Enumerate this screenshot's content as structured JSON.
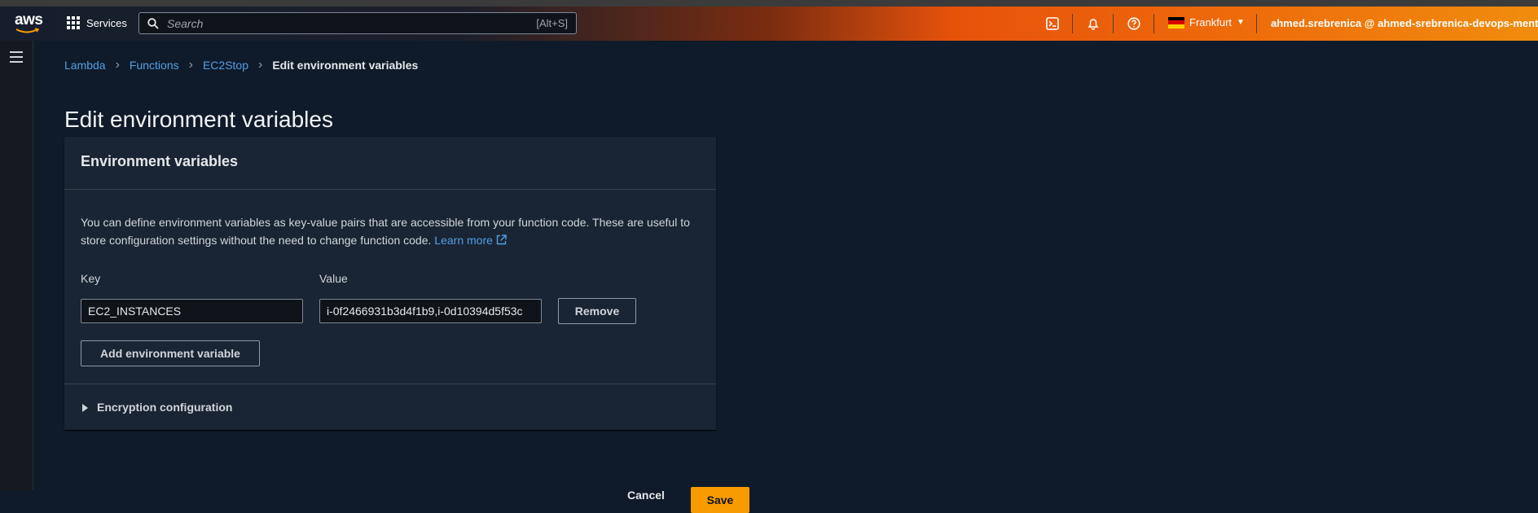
{
  "nav": {
    "logo_text": "aws",
    "services_label": "Services",
    "search_placeholder": "Search",
    "search_shortcut": "[Alt+S]",
    "region": "Frankfurt",
    "account": "ahmed.srebrenica @ ahmed-srebrenica-devops-mentorship",
    "icons": [
      "cloudshell-icon",
      "bell-icon",
      "help-icon"
    ]
  },
  "breadcrumb": {
    "items": [
      "Lambda",
      "Functions",
      "EC2Stop"
    ],
    "current": "Edit environment variables"
  },
  "page": {
    "title": "Edit environment variables"
  },
  "env": {
    "title": "Environment variables",
    "description": "You can define environment variables as key-value pairs that are accessible from your function code. These are useful to store configuration settings without the need to change function code.",
    "learn_more": "Learn more",
    "key_label": "Key",
    "value_label": "Value",
    "variables": [
      {
        "key": "EC2_INSTANCES",
        "value": "i-0f2466931b3d4f1b9,i-0d10394d5f53c"
      }
    ],
    "remove_label": "Remove",
    "add_label": "Add environment variable",
    "encryption_label": "Encryption configuration"
  },
  "actions": {
    "cancel_label": "Cancel",
    "save_label": "Save"
  },
  "colors": {
    "accent": "#f89b00",
    "link": "#539fe5",
    "background": "#0f1b2a"
  }
}
